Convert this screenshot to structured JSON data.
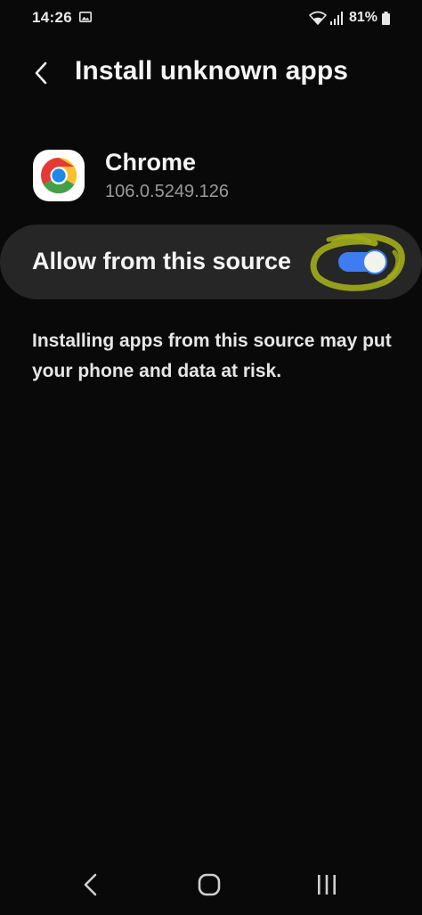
{
  "status_bar": {
    "time": "14:26",
    "battery_percent": "81%",
    "icons": [
      "gallery-icon",
      "wifi-icon",
      "signal-icon",
      "battery-icon"
    ]
  },
  "header": {
    "title": "Install unknown apps",
    "back_icon": "chevron-left-icon"
  },
  "app": {
    "name": "Chrome",
    "version": "106.0.5249.126",
    "icon": "chrome-logo-icon"
  },
  "allow_setting": {
    "label": "Allow from this source",
    "enabled": true
  },
  "warning": "Installing apps from this source may put your phone and data at risk.",
  "navigation": {
    "icons": [
      "back-nav-icon",
      "home-nav-icon",
      "recents-nav-icon"
    ]
  },
  "colors": {
    "background": "#090909",
    "row_background": "#262626",
    "toggle_on": "#3f7cf2",
    "annotation": "#9aa51a"
  }
}
